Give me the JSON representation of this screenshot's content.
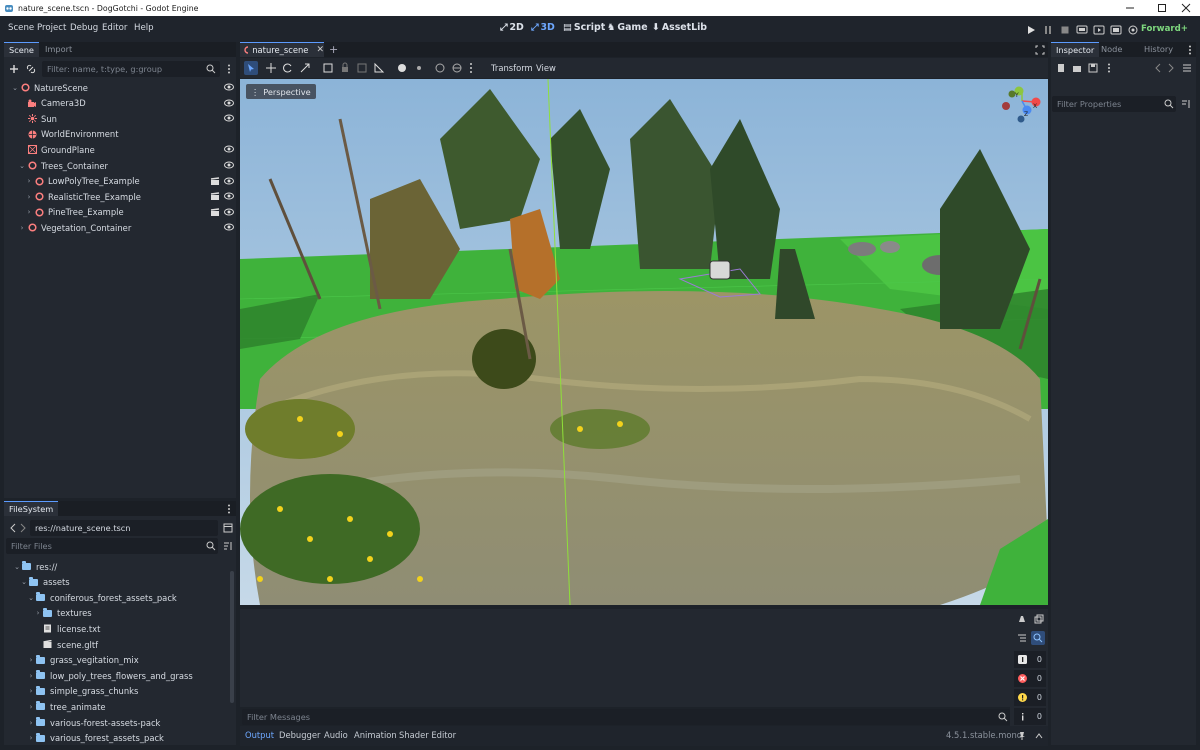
{
  "window": {
    "title": "nature_scene.tscn - DogGotchi - Godot Engine",
    "controls": [
      "minimize-icon",
      "maximize-icon",
      "close-icon"
    ]
  },
  "menu": [
    "Scene",
    "Project",
    "Debug",
    "Editor",
    "Help"
  ],
  "workspaces": [
    {
      "label": "2D",
      "icon": "2d-icon",
      "active": false
    },
    {
      "label": "3D",
      "icon": "3d-icon",
      "active": true
    },
    {
      "label": "Script",
      "icon": "script-icon",
      "active": false
    },
    {
      "label": "Game",
      "icon": "game-icon",
      "active": false
    },
    {
      "label": "AssetLib",
      "icon": "assetlib-icon",
      "active": false
    }
  ],
  "renderer": "Forward+",
  "scene_dock": {
    "tabs": [
      "Scene",
      "Import"
    ],
    "filter_placeholder": "Filter: name, t:type, g:group",
    "nodes": [
      {
        "label": "NatureScene",
        "depth": 0,
        "icon": "node3d-icon",
        "expanded": true,
        "visible": true
      },
      {
        "label": "Camera3D",
        "depth": 1,
        "icon": "camera-icon",
        "visible": true
      },
      {
        "label": "Sun",
        "depth": 1,
        "icon": "sun-icon",
        "visible": true
      },
      {
        "label": "WorldEnvironment",
        "depth": 1,
        "icon": "world-environment-icon"
      },
      {
        "label": "GroundPlane",
        "depth": 1,
        "icon": "mesh-icon",
        "visible": true
      },
      {
        "label": "Trees_Container",
        "depth": 1,
        "icon": "node3d-icon",
        "expanded": true,
        "visible": true
      },
      {
        "label": "LowPolyTree_Example",
        "depth": 2,
        "icon": "node3d-icon",
        "collapsed": true,
        "scene": true,
        "visible": true
      },
      {
        "label": "RealisticTree_Example",
        "depth": 2,
        "icon": "node3d-icon",
        "collapsed": true,
        "scene": true,
        "visible": true
      },
      {
        "label": "PineTree_Example",
        "depth": 2,
        "icon": "node3d-icon",
        "collapsed": true,
        "scene": true,
        "visible": true
      },
      {
        "label": "Vegetation_Container",
        "depth": 1,
        "icon": "node3d-icon",
        "collapsed": true,
        "visible": true
      }
    ]
  },
  "filesystem": {
    "tab": "FileSystem",
    "path": "res://nature_scene.tscn",
    "filter_placeholder": "Filter Files",
    "items": [
      {
        "label": "res://",
        "depth": 0,
        "type": "folder",
        "expanded": true
      },
      {
        "label": "assets",
        "depth": 1,
        "type": "folder",
        "expanded": true
      },
      {
        "label": "coniferous_forest_assets_pack",
        "depth": 2,
        "type": "folder",
        "expanded": true
      },
      {
        "label": "textures",
        "depth": 3,
        "type": "folder",
        "collapsed": true
      },
      {
        "label": "license.txt",
        "depth": 3,
        "type": "text"
      },
      {
        "label": "scene.gltf",
        "depth": 3,
        "type": "scene"
      },
      {
        "label": "grass_vegitation_mix",
        "depth": 2,
        "type": "folder",
        "collapsed": true
      },
      {
        "label": "low_poly_trees_flowers_and_grass",
        "depth": 2,
        "type": "folder",
        "collapsed": true
      },
      {
        "label": "simple_grass_chunks",
        "depth": 2,
        "type": "folder",
        "collapsed": true
      },
      {
        "label": "tree_animate",
        "depth": 2,
        "type": "folder",
        "collapsed": true
      },
      {
        "label": "various-forest-assets-pack",
        "depth": 2,
        "type": "folder",
        "collapsed": true
      },
      {
        "label": "various_forest_assets_pack",
        "depth": 2,
        "type": "folder",
        "collapsed": true
      }
    ]
  },
  "editor_tabs": {
    "open": "nature_scene",
    "add": "+"
  },
  "viewport": {
    "toolbar_menus": [
      "Transform",
      "View"
    ],
    "perspective_label": "Perspective",
    "gizmo_axes": [
      "Y",
      "X",
      "Z"
    ]
  },
  "inspector": {
    "tabs": [
      "Inspector",
      "Node",
      "History"
    ],
    "filter_placeholder": "Filter Properties"
  },
  "output": {
    "filter_placeholder": "Filter Messages",
    "counters": [
      {
        "icon": "message-icon",
        "value": "0"
      },
      {
        "icon": "error-icon",
        "value": "0"
      },
      {
        "icon": "warning-icon",
        "value": "0"
      },
      {
        "icon": "info-icon",
        "value": "0"
      }
    ]
  },
  "bottom_tabs": [
    "Output",
    "Debugger",
    "Audio",
    "Animation",
    "Shader Editor"
  ],
  "version": "4.5.1.stable.mono",
  "colors": {
    "accent": "#5c9bff",
    "node_icon": "#fc7f7f",
    "folder": "#8ec3f2",
    "renderer": "#7ed87e"
  }
}
